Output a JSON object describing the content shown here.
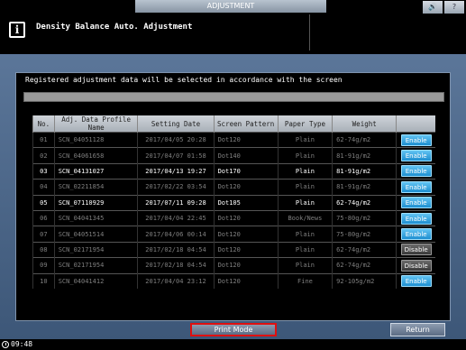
{
  "window": {
    "title": "ADJUSTMENT",
    "sound_icon": "speaker-icon",
    "help_label": "?"
  },
  "header": {
    "info_icon": "i",
    "title": "Density Balance Auto. Adjustment"
  },
  "message": "Registered adjustment data will be selected in accordance with the screen",
  "table": {
    "headers": [
      "No.",
      "Adj. Data Profile Name",
      "Setting Date",
      "Screen Pattern",
      "Paper Type",
      "Weight",
      ""
    ],
    "rows": [
      {
        "no": "01",
        "name": "SCN_04051128",
        "date": "2017/04/05 20:28",
        "pattern": "Dot120",
        "paper": "Plain",
        "weight": "62-74g/m2",
        "state": "Enable",
        "active": false
      },
      {
        "no": "02",
        "name": "SCN_04061658",
        "date": "2017/04/07 01:58",
        "pattern": "Dot140",
        "paper": "Plain",
        "weight": "81-91g/m2",
        "state": "Enable",
        "active": false
      },
      {
        "no": "03",
        "name": "SCN_04131027",
        "date": "2017/04/13 19:27",
        "pattern": "Dot170",
        "paper": "Plain",
        "weight": "81-91g/m2",
        "state": "Enable",
        "active": true
      },
      {
        "no": "04",
        "name": "SCN_02211854",
        "date": "2017/02/22 03:54",
        "pattern": "Dot120",
        "paper": "Plain",
        "weight": "81-91g/m2",
        "state": "Enable",
        "active": false
      },
      {
        "no": "05",
        "name": "SCN_07110929",
        "date": "2017/07/11 09:28",
        "pattern": "Dot105",
        "paper": "Plain",
        "weight": "62-74g/m2",
        "state": "Enable",
        "active": true
      },
      {
        "no": "06",
        "name": "SCN_04041345",
        "date": "2017/04/04 22:45",
        "pattern": "Dot120",
        "paper": "Book/News",
        "weight": "75-80g/m2",
        "state": "Enable",
        "active": false
      },
      {
        "no": "07",
        "name": "SCN_04051514",
        "date": "2017/04/06 00:14",
        "pattern": "Dot120",
        "paper": "Plain",
        "weight": "75-80g/m2",
        "state": "Enable",
        "active": false
      },
      {
        "no": "08",
        "name": "SCN_02171954",
        "date": "2017/02/18 04:54",
        "pattern": "Dot120",
        "paper": "Plain",
        "weight": "62-74g/m2",
        "state": "Disable",
        "active": false
      },
      {
        "no": "09",
        "name": "SCN_02171954",
        "date": "2017/02/18 04:54",
        "pattern": "Dot120",
        "paper": "Plain",
        "weight": "62-74g/m2",
        "state": "Disable",
        "active": false
      },
      {
        "no": "10",
        "name": "SCN_04041412",
        "date": "2017/04/04 23:12",
        "pattern": "Dot120",
        "paper": "Fine",
        "weight": "92-105g/m2",
        "state": "Enable",
        "active": false
      }
    ]
  },
  "buttons": {
    "print_mode": "Print Mode",
    "return": "Return"
  },
  "footer": {
    "time": "09:48"
  },
  "colors": {
    "enable": "#1e8fd0",
    "disable": "#3a3a3a",
    "panel": "#4d6789",
    "highlight_border": "#e01010"
  }
}
